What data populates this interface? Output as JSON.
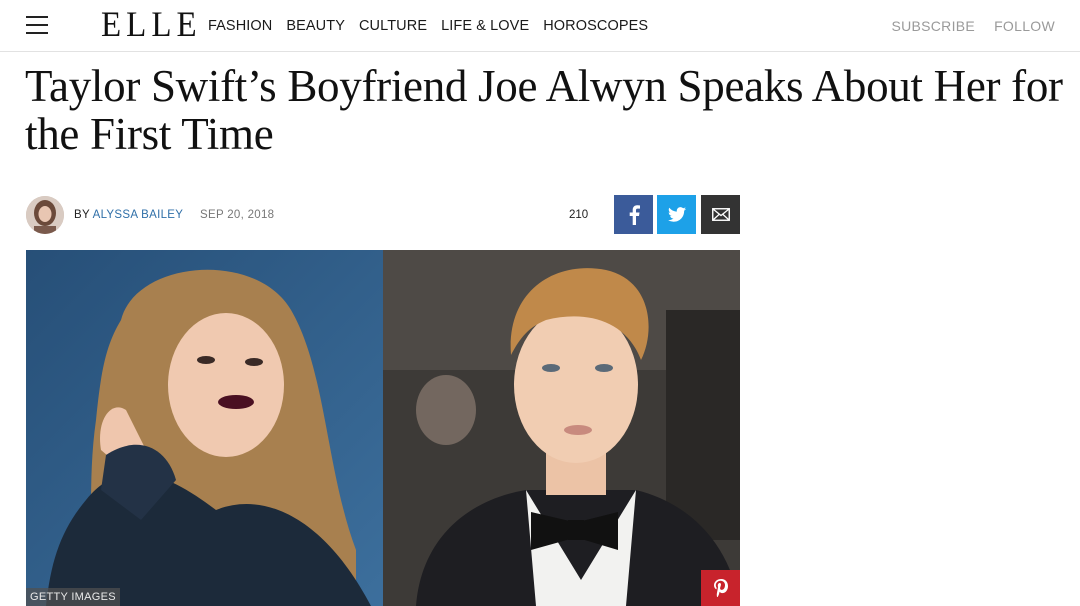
{
  "header": {
    "logo": "ELLE",
    "nav": [
      "FASHION",
      "BEAUTY",
      "CULTURE",
      "LIFE & LOVE",
      "HOROSCOPES"
    ],
    "subscribe_label": "SUBSCRIBE",
    "follow_label": "FOLLOW"
  },
  "article": {
    "headline": "Taylor Swift’s Boyfriend Joe Alwyn Speaks About Her for the First Time",
    "byline_prefix": "BY",
    "author": "ALYSSA BAILEY",
    "date": "SEP 20, 2018",
    "share_count": "210",
    "image_credit": "GETTY IMAGES"
  },
  "icons": {
    "menu": "hamburger-menu-icon",
    "facebook": "facebook-icon",
    "twitter": "twitter-icon",
    "email": "email-icon",
    "pinterest": "pinterest-icon"
  },
  "colors": {
    "facebook": "#3b5b9a",
    "twitter": "#1da1e8",
    "email": "#333333",
    "pinterest": "#c8232c",
    "author_link": "#2f6fa8"
  }
}
